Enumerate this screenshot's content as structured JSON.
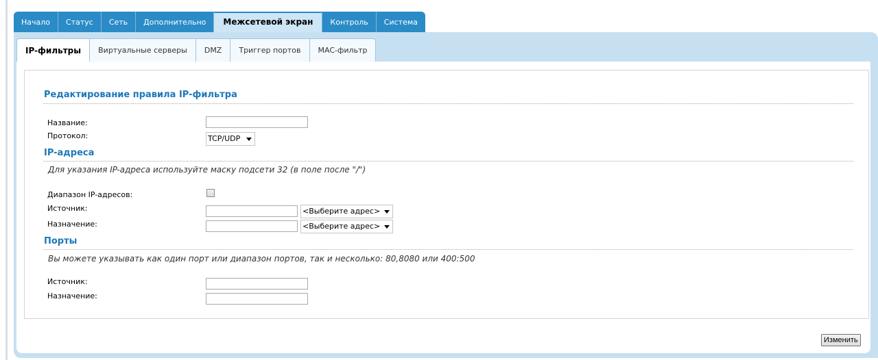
{
  "top_tabs": [
    {
      "label": "Начало"
    },
    {
      "label": "Статус"
    },
    {
      "label": "Сеть"
    },
    {
      "label": "Дополнительно"
    },
    {
      "label": "Межсетевой экран"
    },
    {
      "label": "Контроль"
    },
    {
      "label": "Система"
    }
  ],
  "top_tabs_active": "Межсетевой экран",
  "sub_tabs": [
    {
      "label": "IP-фильтры"
    },
    {
      "label": "Виртуальные серверы"
    },
    {
      "label": "DMZ"
    },
    {
      "label": "Триггер портов"
    },
    {
      "label": "MAC-фильтр"
    }
  ],
  "sub_tabs_active": "IP-фильтры",
  "form": {
    "title": "Редактирование правила IP-фильтра",
    "name_label": "Название:",
    "name_value": "",
    "protocol_label": "Протокол:",
    "protocol_value": "TCP/UDP"
  },
  "ip_section": {
    "title": "IP-адреса",
    "note": "Для указания IP-адреса используйте маску подсети 32 (в поле после \"/\")",
    "range_label": "Диапазон IP-адресов:",
    "range_checked": false,
    "source_label": "Источник:",
    "source_value": "",
    "source_select": "<Выберите адрес>",
    "dest_label": "Назначение:",
    "dest_value": "",
    "dest_select": "<Выберите адрес>"
  },
  "ports_section": {
    "title": "Порты",
    "note": "Вы можете указывать как один порт или диапазон портов, так и несколько: 80,8080 или 400:500",
    "source_label": "Источник:",
    "source_value": "",
    "dest_label": "Назначение:",
    "dest_value": ""
  },
  "buttons": {
    "change_label": "Изменить"
  },
  "colors": {
    "tab_blue": "#2a8bc7",
    "panel_blue": "#c6e0f1",
    "heading_blue": "#1c78b8"
  }
}
